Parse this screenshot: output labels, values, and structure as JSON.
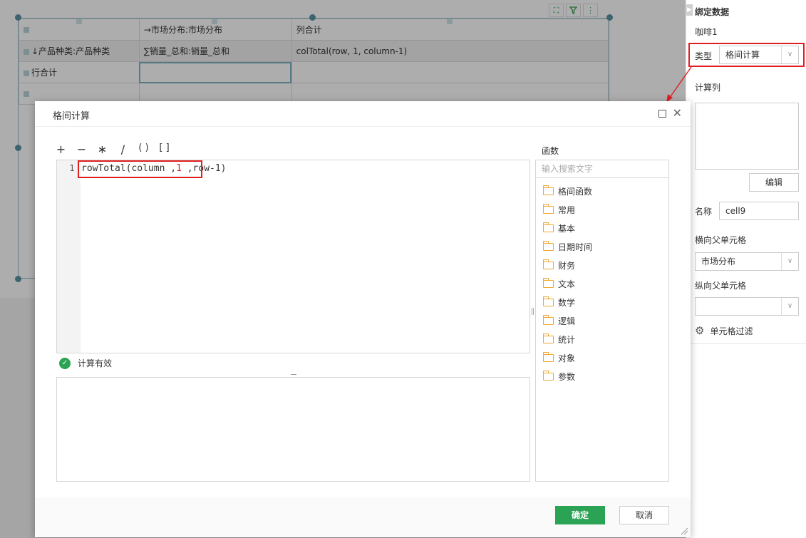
{
  "report": {
    "header_col2": "→市场分布:市场分布",
    "header_col3": "列合计",
    "row1_col1": "↓产品种类:产品种类",
    "row1_col2": "∑销量_总和:销量_总和",
    "row1_col3": "colTotal(row, 1, column-1)",
    "row2_col1": "行合计"
  },
  "right_panel": {
    "title": "绑定数据",
    "dataset": "咖啡1",
    "type_label": "类型",
    "type_value": "格间计算",
    "calc_col_label": "计算列",
    "edit_button": "编辑",
    "name_label": "名称",
    "name_value": "cell9",
    "h_parent_label": "横向父单元格",
    "h_parent_value": "市场分布",
    "v_parent_label": "纵向父单元格",
    "v_parent_value": "",
    "cell_filter_label": "单元格过滤"
  },
  "dialog": {
    "title": "格间计算",
    "ops": [
      "+",
      "−",
      "∗",
      "/",
      "( )",
      "[ ]"
    ],
    "line_number": "1",
    "code_a": "rowTotal(column ,",
    "code_num": "1",
    "code_b": " ,row-1)",
    "valid_text": "计算有效",
    "functions_label": "函数",
    "search_placeholder": "输入搜索文字",
    "functions": [
      "格间函数",
      "常用",
      "基本",
      "日期时间",
      "财务",
      "文本",
      "数学",
      "逻辑",
      "统计",
      "对象",
      "参数"
    ],
    "ok_button": "确定",
    "cancel_button": "取消"
  },
  "colors": {
    "accent": "#2aa354",
    "highlight": "#e02020",
    "folder": "#f0a830"
  }
}
